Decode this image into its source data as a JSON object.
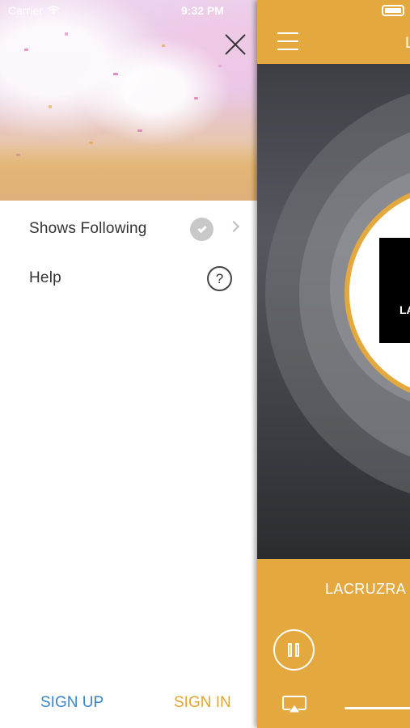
{
  "status_bar": {
    "carrier": "Carrier",
    "time": "9:32 PM"
  },
  "menu": {
    "items": [
      {
        "label": "Shows Following",
        "icon": "check-circle-icon",
        "trailing": "chevron-right-icon"
      },
      {
        "label": "Help",
        "icon": "question-circle-icon"
      }
    ],
    "help_glyph": "?",
    "sign_up": "SIGN UP",
    "sign_in": "SIGN IN"
  },
  "player": {
    "title_fragment": "L",
    "logo_fragment": "LA",
    "station_fragment": "LACRUZRA"
  },
  "colors": {
    "accent": "#e3a93e",
    "sign_up": "#3a86c8",
    "sign_in": "#e4a530"
  }
}
